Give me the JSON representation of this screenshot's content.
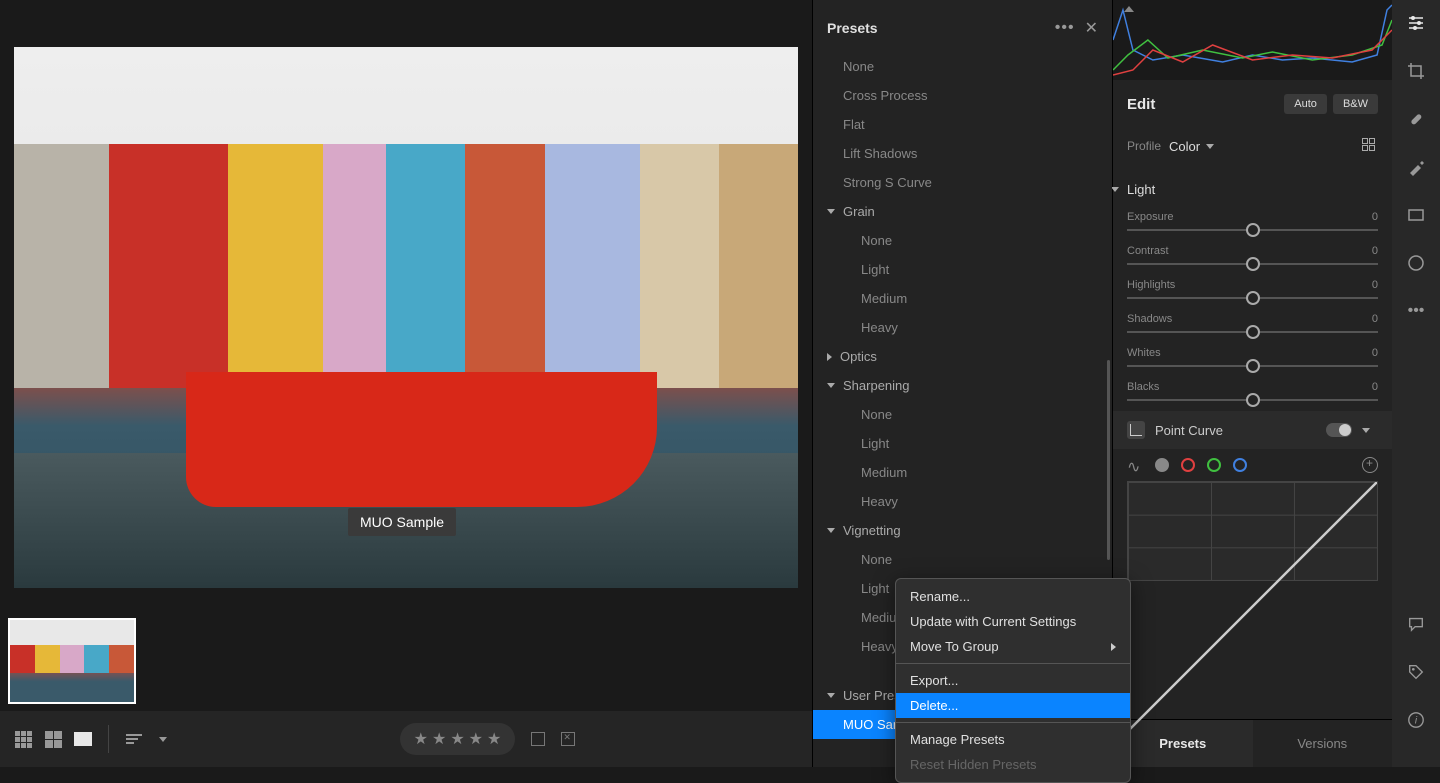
{
  "tooltip": "MUO Sample",
  "presets_panel": {
    "title": "Presets",
    "items_flat": [
      "None",
      "Cross Process",
      "Flat",
      "Lift Shadows",
      "Strong S Curve"
    ],
    "groups": [
      {
        "name": "Grain",
        "expanded": true,
        "items": [
          "None",
          "Light",
          "Medium",
          "Heavy"
        ]
      },
      {
        "name": "Optics",
        "expanded": false,
        "items": []
      },
      {
        "name": "Sharpening",
        "expanded": true,
        "items": [
          "None",
          "Light",
          "Medium",
          "Heavy"
        ]
      },
      {
        "name": "Vignetting",
        "expanded": true,
        "items": [
          "None",
          "Light",
          "Medium",
          "Heavy"
        ]
      }
    ],
    "user_presets_label": "User Presets",
    "user_preset_selected": "MUO Sample"
  },
  "context_menu": {
    "rename": "Rename...",
    "update": "Update with Current Settings",
    "move": "Move To Group",
    "export": "Export...",
    "delete": "Delete...",
    "manage": "Manage Presets",
    "reset": "Reset Hidden Presets"
  },
  "edit_panel": {
    "title": "Edit",
    "auto": "Auto",
    "bw": "B&W",
    "profile_label": "Profile",
    "profile_value": "Color",
    "light_section": "Light",
    "sliders": {
      "exposure": {
        "label": "Exposure",
        "value": "0"
      },
      "contrast": {
        "label": "Contrast",
        "value": "0"
      },
      "highlights": {
        "label": "Highlights",
        "value": "0"
      },
      "shadows": {
        "label": "Shadows",
        "value": "0"
      },
      "whites": {
        "label": "Whites",
        "value": "0"
      },
      "blacks": {
        "label": "Blacks",
        "value": "0"
      }
    },
    "point_curve": "Point Curve"
  },
  "bottom_tabs": {
    "presets": "Presets",
    "versions": "Versions"
  }
}
